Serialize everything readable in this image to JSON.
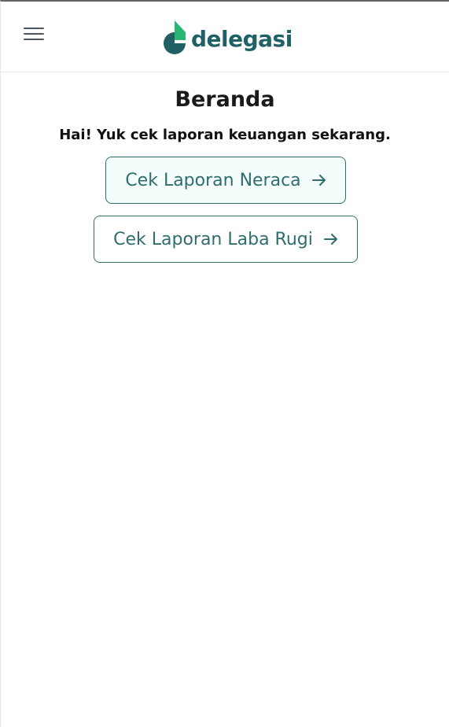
{
  "header": {
    "menu_icon": "hamburger-menu-icon",
    "logo_icon": "delegasi-logo-icon",
    "logo_text": "delegasi",
    "brand_color": "#1f6164",
    "accent_color": "#2bb673"
  },
  "main": {
    "title": "Beranda",
    "greeting": "Hai! Yuk cek laporan keuangan sekarang.",
    "buttons": [
      {
        "label": "Cek Laporan Neraca",
        "icon": "arrow-right-icon"
      },
      {
        "label": "Cek Laporan Laba Rugi",
        "icon": "arrow-right-icon"
      }
    ]
  }
}
